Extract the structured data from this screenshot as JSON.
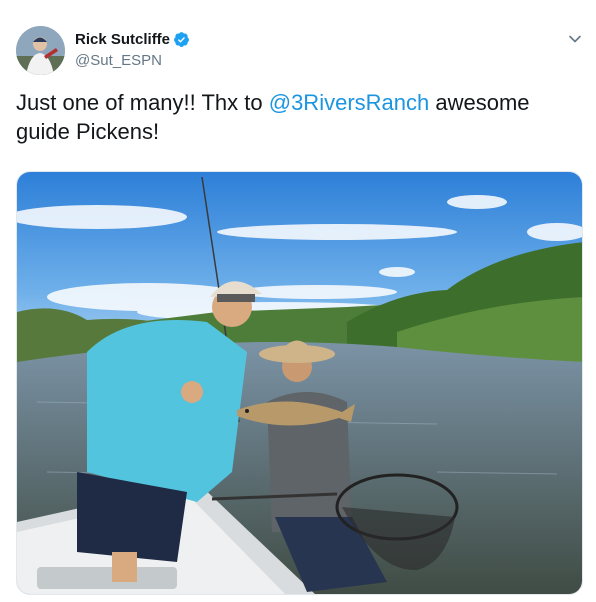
{
  "author": {
    "display_name": "Rick Sutcliffe",
    "handle": "@Sut_ESPN",
    "verified": true
  },
  "tweet": {
    "text_before": "Just one of many!! Thx to ",
    "mention": "@3RiversRanch",
    "text_after": " awesome guide Pickens!"
  },
  "icons": {
    "verified": "verified-badge-icon",
    "menu": "chevron-down-icon"
  },
  "colors": {
    "mention": "#1b95e0",
    "verified": "#1da1f2",
    "handle": "#657786"
  }
}
